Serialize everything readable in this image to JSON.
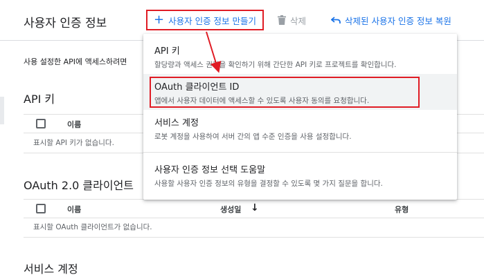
{
  "header": {
    "title": "사용자 인증 정보",
    "create_label": "사용자 인증 정보 만들기",
    "delete_label": "삭제",
    "restore_label": "삭제된 사용자 인증 정보 복원"
  },
  "description": "사용 설정한 API에 액세스하려면",
  "sections": {
    "api_keys": {
      "title": "API 키",
      "col_name": "이름",
      "empty": "표시할 API 키가 없습니다."
    },
    "oauth": {
      "title": "OAuth 2.0 클라이언트",
      "col_name": "이름",
      "col_created": "생성일",
      "col_created_sort": "↓",
      "col_type": "유형",
      "empty": "표시할 OAuth 클라이언트가 없습니다."
    },
    "service_accounts": {
      "title": "서비스 계정"
    }
  },
  "menu": {
    "items": [
      {
        "title": "API 키",
        "desc": "할당량과 액세스 권한을 확인하기 위해 간단한 API 키로 프로젝트를 확인합니다."
      },
      {
        "title": "OAuth 클라이언트 ID",
        "desc": "앱에서 사용자 데이터에 액세스할 수 있도록 사용자 동의를 요청합니다."
      },
      {
        "title": "서비스 계정",
        "desc": "로봇 계정을 사용하여 서버 간의 앱 수준 인증을 사용 설정합니다."
      },
      {
        "title": "사용자 인증 정보 선택 도움말",
        "desc": "사용할 사용자 인증 정보의 유형을 결정할 수 있도록 몇 가지 질문을 합니다."
      }
    ]
  },
  "colors": {
    "accent": "#1a73e8",
    "annotation_red": "#e01b24",
    "disabled": "#9aa0a6"
  }
}
